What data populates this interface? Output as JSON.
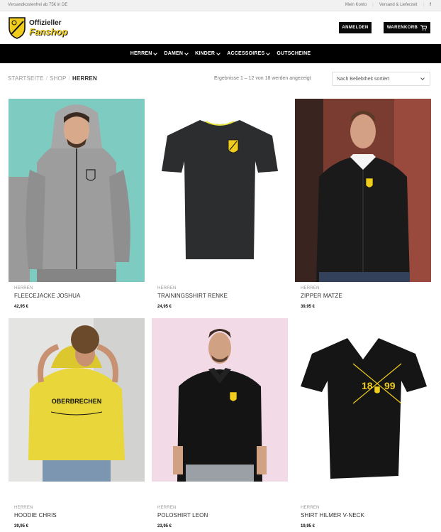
{
  "topbar": {
    "shipping_note": "Versandkostenfrei ab 75€ in DE",
    "links": [
      "Mein Konto",
      "Versand & Lieferzeit"
    ],
    "facebook_glyph": "f"
  },
  "logo": {
    "line1": "Offizieller",
    "line2": "Fanshop"
  },
  "header": {
    "login": "ANMELDEN",
    "cart": "WARENKORB"
  },
  "nav": {
    "items": [
      {
        "label": "HERREN",
        "dropdown": true
      },
      {
        "label": "DAMEN",
        "dropdown": true
      },
      {
        "label": "KINDER",
        "dropdown": true
      },
      {
        "label": "ACCESSOIRES",
        "dropdown": true
      },
      {
        "label": "GUTSCHEINE",
        "dropdown": false
      }
    ]
  },
  "breadcrumb": {
    "home": "STARTSEITE",
    "shop": "SHOP",
    "current": "HERREN",
    "separator": "/"
  },
  "results": {
    "text": "Ergebnisse 1 – 12 von 18 werden angezeigt"
  },
  "sort": {
    "selected": "Nach Beliebtheit sortiert"
  },
  "colors": {
    "brand_yellow": "#f0cd1c",
    "nav_black": "#000000",
    "bg_teal": "#7ecbc1",
    "bg_pink": "#f2dbe6"
  },
  "products": [
    {
      "category": "HERREN",
      "title": "FLEECEJACKE JOSHUA",
      "price": "42,95 €"
    },
    {
      "category": "HERREN",
      "title": "TRAININGSSHIRT RENKE",
      "price": "24,95 €"
    },
    {
      "category": "HERREN",
      "title": "ZIPPER MATZE",
      "price": "39,95 €"
    },
    {
      "category": "HERREN",
      "title": "HOODIE CHRIS",
      "price": "39,95 €"
    },
    {
      "category": "HERREN",
      "title": "POLOSHIRT LEON",
      "price": "23,95 €"
    },
    {
      "category": "HERREN",
      "title": "SHIRT HILMER V-NECK",
      "price": "19,95 €"
    }
  ],
  "print": {
    "hoodie_text": "OBERBRECHEN",
    "year_left": "18",
    "year_right": "99"
  }
}
